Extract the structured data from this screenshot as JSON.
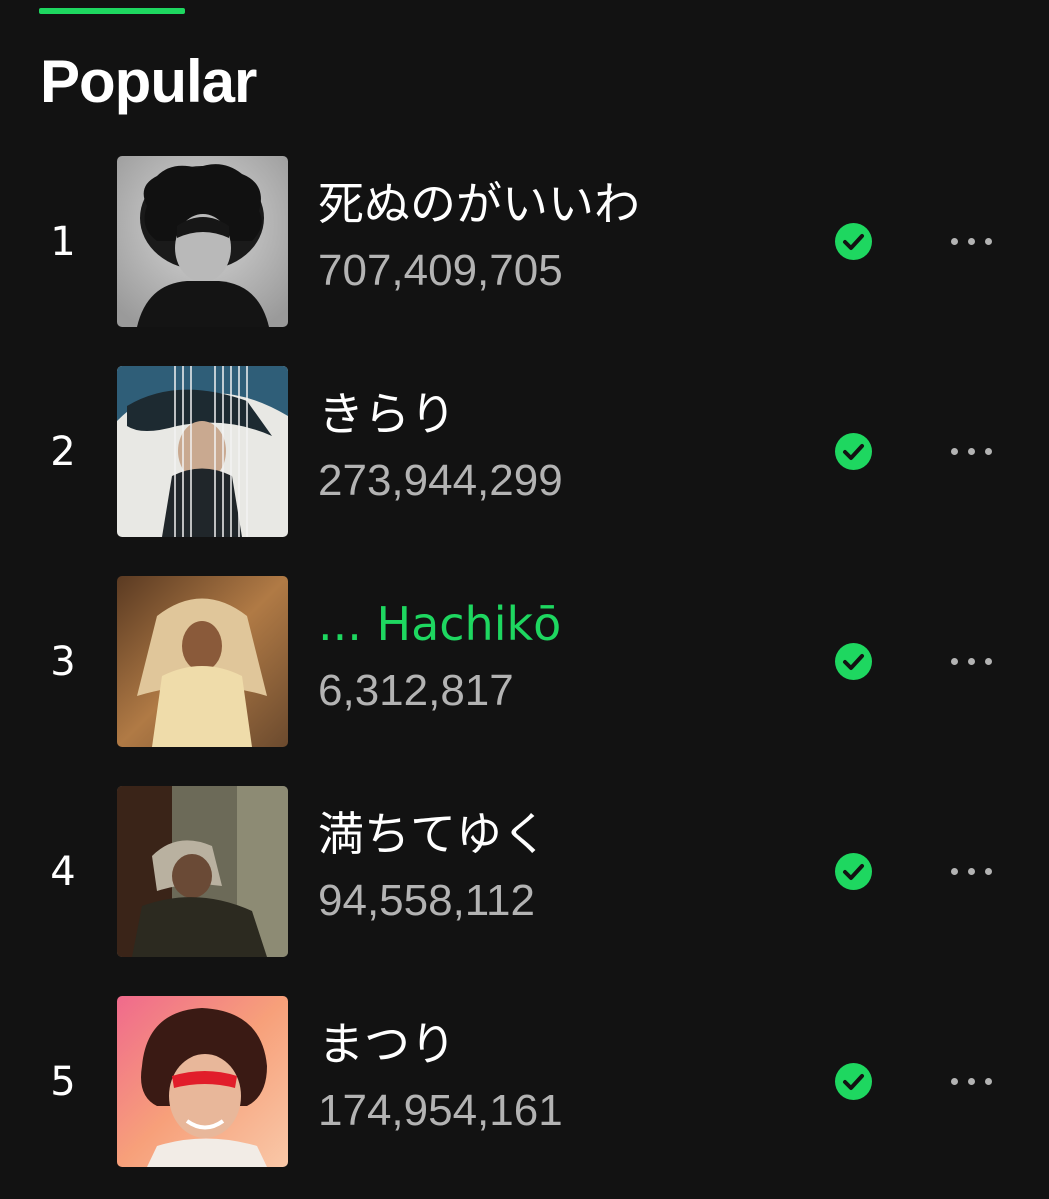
{
  "section": {
    "title": "Popular",
    "indicator_color": "#1ed760"
  },
  "colors": {
    "background": "#121212",
    "accent": "#1ed760",
    "secondary_text": "#b3b3b3"
  },
  "tracks": [
    {
      "rank": "1",
      "title": "死ぬのがいいわ",
      "plays": "707,409,705",
      "playing": false,
      "saved_icon": "check-circle-icon",
      "more_icon": "more-options-icon"
    },
    {
      "rank": "2",
      "title": "きらり",
      "plays": "273,944,299",
      "playing": false,
      "saved_icon": "check-circle-icon",
      "more_icon": "more-options-icon"
    },
    {
      "rank": "3",
      "title": "... Hachikō",
      "plays": "6,312,817",
      "playing": true,
      "saved_icon": "check-circle-icon",
      "more_icon": "more-options-icon"
    },
    {
      "rank": "4",
      "title": "満ちてゆく",
      "plays": "94,558,112",
      "playing": false,
      "saved_icon": "check-circle-icon",
      "more_icon": "more-options-icon"
    },
    {
      "rank": "5",
      "title": "まつり",
      "plays": "174,954,161",
      "playing": false,
      "saved_icon": "check-circle-icon",
      "more_icon": "more-options-icon"
    }
  ]
}
